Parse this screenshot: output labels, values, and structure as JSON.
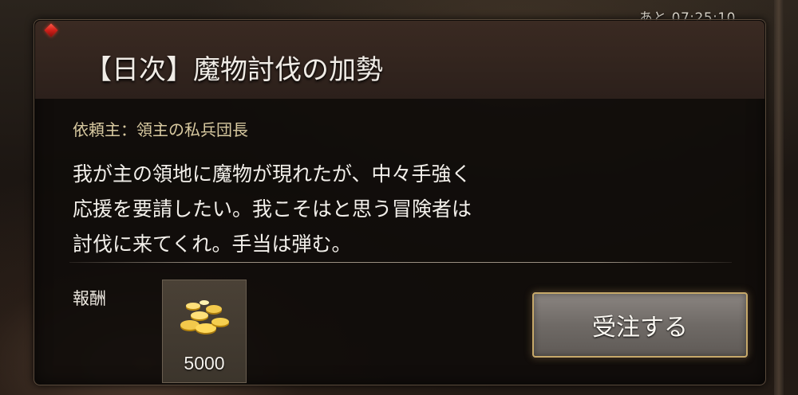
{
  "timer": {
    "text": "あと 07:25:10"
  },
  "quest": {
    "title": "【日次】魔物討伐の加勢",
    "client_label": "依頼主：",
    "client_name": "領主の私兵団長",
    "description_lines": [
      "我が主の領地に魔物が現れたが、中々手強く",
      "応援を要請したい。我こそはと思う冒険者は",
      "討伐に来てくれ。手当は弾む。"
    ]
  },
  "reward": {
    "label": "報酬",
    "items": [
      {
        "icon": "gold-coins-icon",
        "quantity": "5000"
      }
    ]
  },
  "actions": {
    "accept_label": "受注する"
  },
  "colors": {
    "accent_gem": "#d0201a",
    "button_border": "#c7a96a",
    "client_text": "#d8c9a0"
  }
}
